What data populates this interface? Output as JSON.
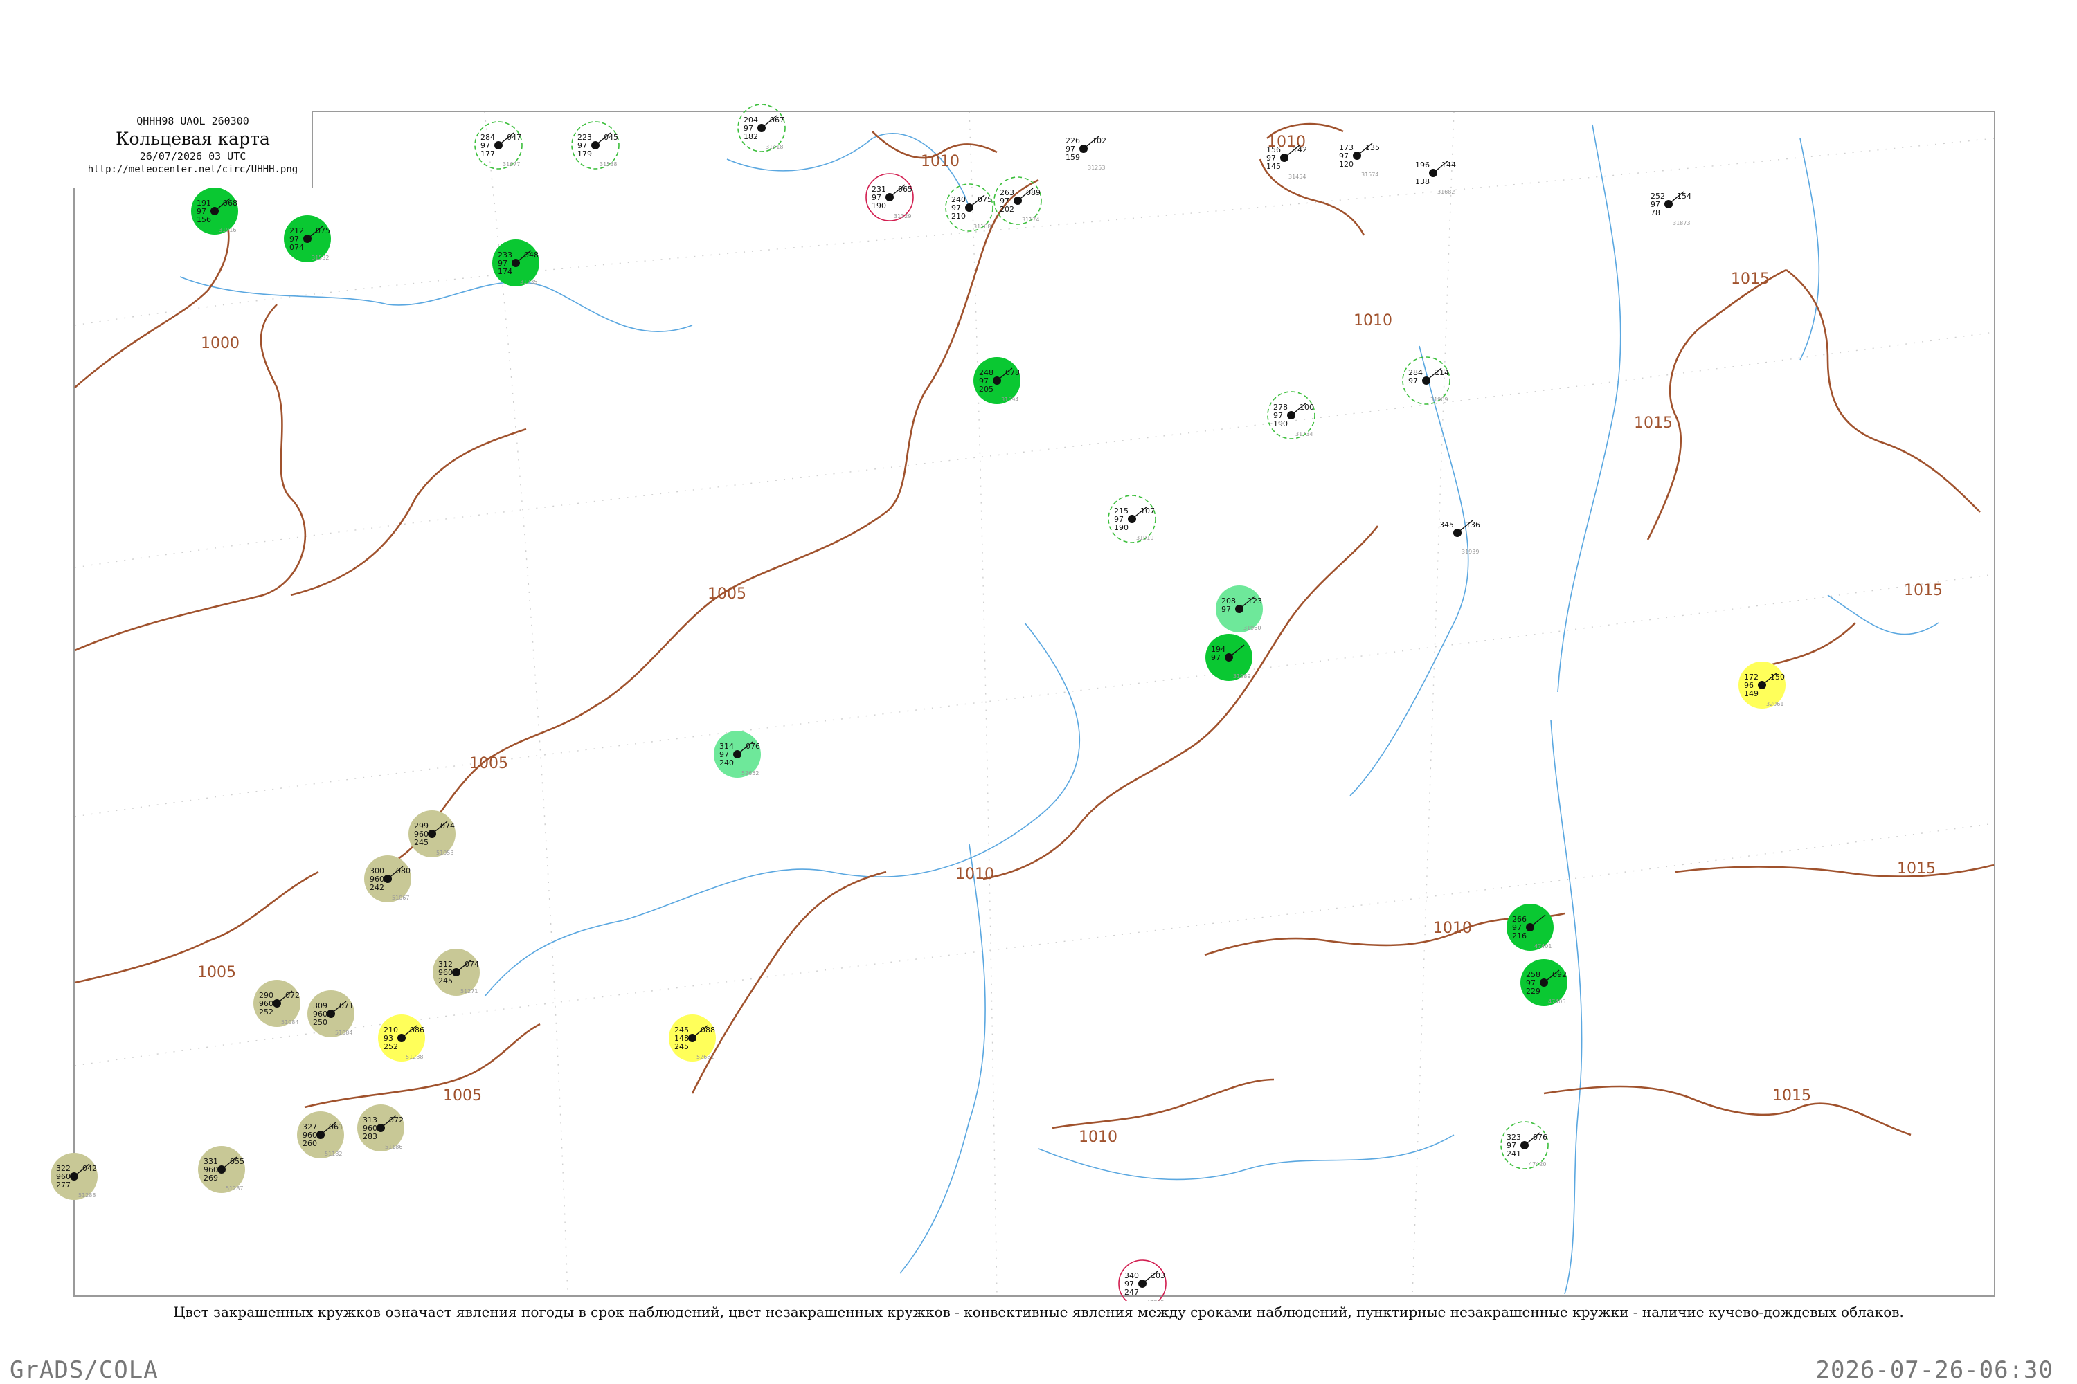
{
  "info_box": {
    "code_line": "QHHH98  UAOL  260300",
    "title": "Кольцевая карта",
    "date": "26/07/2026 03 UTC",
    "url": "http://meteocenter.net/circ/UHHH.png"
  },
  "caption": "Цвет закрашенных кружков означает явления погоды в срок наблюдений, цвет незакрашенных кружков - конвективные явления между сроками наблюдений, пунктирные незакрашенные кружки - наличие кучево-дождевых облаков.",
  "footer": {
    "left": "GrADS/COLA",
    "right": "2026-07-26-06:30"
  },
  "colors": {
    "isobar": "#a0522d",
    "river": "#5aa7e0",
    "rain": "#0ac832",
    "drizzle": "#6ee89a",
    "haze": "#c8c896",
    "dust": "#ffff5a",
    "cb_dashed": "#3cbf3c",
    "thunder_ring": "#d21e50"
  },
  "isobar_labels": [
    "1000",
    "1005",
    "1005",
    "1005",
    "1005",
    "1010",
    "1010",
    "1010",
    "1010",
    "1010",
    "1010",
    "1015",
    "1015",
    "1015",
    "1015",
    "1015"
  ],
  "stations": [
    {
      "p": "191",
      "t": "97",
      "td": "156",
      "tend": "068",
      "wx": "rain",
      "id": "31916"
    },
    {
      "p": "212",
      "t": "97",
      "td": "074",
      "tend": "075",
      "wx": "rain",
      "id": "31532"
    },
    {
      "p": "233",
      "t": "97",
      "td": "174",
      "tend": "048",
      "wx": "rain",
      "id": "31735"
    },
    {
      "p": "284",
      "t": "97",
      "td": "177",
      "tend": "047",
      "wx": "cb",
      "id": "31677"
    },
    {
      "p": "223",
      "t": "97",
      "td": "179",
      "tend": "045",
      "wx": "cb",
      "id": "31538"
    },
    {
      "p": "204",
      "t": "97",
      "td": "182",
      "tend": "067",
      "wx": "cb",
      "id": "31418"
    },
    {
      "p": "231",
      "t": "97",
      "td": "190",
      "tend": "065",
      "wx": "thunder",
      "id": "31329"
    },
    {
      "p": "240",
      "t": "97",
      "td": "210",
      "tend": "075",
      "wx": "cb",
      "id": "31168"
    },
    {
      "p": "263",
      "t": "97",
      "td": "202",
      "tend": "089",
      "wx": "cb",
      "id": "31174"
    },
    {
      "p": "226",
      "t": "97",
      "td": "159",
      "tend": "102",
      "wx": "none",
      "id": "31253"
    },
    {
      "p": "156",
      "t": "97",
      "td": "145",
      "tend": "142",
      "wx": "none",
      "id": "31454"
    },
    {
      "p": "173",
      "t": "97",
      "td": "120",
      "tend": "135",
      "wx": "none",
      "id": "31574"
    },
    {
      "p": "196",
      "t": "",
      "td": "138",
      "tend": "144",
      "wx": "none",
      "id": "31682"
    },
    {
      "p": "252",
      "t": "97",
      "td": "78",
      "tend": "154",
      "wx": "none",
      "id": "31873"
    },
    {
      "p": "248",
      "t": "97",
      "td": "205",
      "tend": "078",
      "wx": "rain",
      "id": "31594"
    },
    {
      "p": "278",
      "t": "97",
      "td": "190",
      "tend": "100",
      "wx": "cb",
      "id": "31734"
    },
    {
      "p": "284",
      "t": "97",
      "td": "",
      "tend": "114",
      "wx": "cb",
      "id": "31909"
    },
    {
      "p": "215",
      "t": "97",
      "td": "190",
      "tend": "107",
      "wx": "cb",
      "id": "31919"
    },
    {
      "p": "345",
      "t": "",
      "td": "",
      "tend": "136",
      "wx": "none",
      "id": "31939"
    },
    {
      "p": "208",
      "t": "97",
      "td": "",
      "tend": "123",
      "wx": "drizzle",
      "id": "31960"
    },
    {
      "p": "194",
      "t": "97",
      "td": "",
      "tend": "",
      "wx": "rain",
      "id": "31989"
    },
    {
      "p": "172",
      "t": "96",
      "td": "149",
      "tend": "150",
      "wx": "dust",
      "id": "32061"
    },
    {
      "p": "299",
      "t": "9600",
      "td": "245",
      "tend": "074",
      "wx": "haze",
      "id": "51053"
    },
    {
      "p": "300",
      "t": "9600",
      "td": "242",
      "tend": "080",
      "wx": "haze",
      "id": "51067"
    },
    {
      "p": "290",
      "t": "9600",
      "td": "252",
      "tend": "072",
      "wx": "haze",
      "id": "51084"
    },
    {
      "p": "309",
      "t": "9600",
      "td": "250",
      "tend": "071",
      "wx": "haze",
      "id": "51084"
    },
    {
      "p": "327",
      "t": "9600",
      "td": "260",
      "tend": "061",
      "wx": "haze",
      "id": "51182"
    },
    {
      "p": "313",
      "t": "9600",
      "td": "283",
      "tend": "072",
      "wx": "haze",
      "id": "51186"
    },
    {
      "p": "322",
      "t": "9600",
      "td": "277",
      "tend": "042",
      "wx": "haze",
      "id": "51288"
    },
    {
      "p": "331",
      "t": "9600",
      "td": "269",
      "tend": "055",
      "wx": "haze",
      "id": "51287"
    },
    {
      "p": "312",
      "t": "9600",
      "td": "245",
      "tend": "074",
      "wx": "haze",
      "id": "51271"
    },
    {
      "p": "210",
      "t": "93",
      "td": "252",
      "tend": "086",
      "wx": "dust",
      "id": "51288"
    },
    {
      "p": "245",
      "t": "148",
      "td": "245",
      "tend": "088",
      "wx": "dust",
      "id": "52681"
    },
    {
      "p": "314",
      "t": "97",
      "td": "240",
      "tend": "076",
      "wx": "drizzle",
      "id": "52652"
    },
    {
      "p": "1015",
      "t": "",
      "td": "",
      "tend": "",
      "wx": "none",
      "id": ""
    },
    {
      "p": "266",
      "t": "97",
      "td": "216",
      "tend": "",
      "wx": "rain",
      "id": "47401"
    },
    {
      "p": "258",
      "t": "97",
      "td": "229",
      "tend": "092",
      "wx": "rain",
      "id": "47405"
    },
    {
      "p": "323",
      "t": "97",
      "td": "241",
      "tend": "076",
      "wx": "cb",
      "id": "47420"
    },
    {
      "p": "340",
      "t": "97",
      "td": "247",
      "tend": "103",
      "wx": "thunder",
      "id": "47755"
    }
  ]
}
